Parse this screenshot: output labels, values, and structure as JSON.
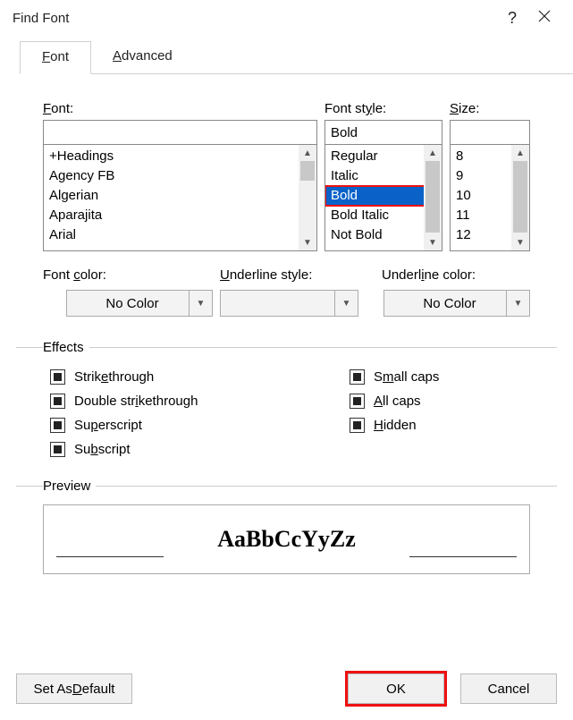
{
  "title": "Find Font",
  "tabs": {
    "font": "Font",
    "advanced": "Advanced"
  },
  "labels": {
    "font": "Font:",
    "style": "Font style:",
    "size": "Size:",
    "fontColor": "Font color:",
    "underlineStyle": "Underline style:",
    "underlineColor": "Underline color:"
  },
  "inputs": {
    "font": "",
    "style": "Bold",
    "size": ""
  },
  "fonts": [
    "+Headings",
    "Agency FB",
    "Algerian",
    "Aparajita",
    "Arial"
  ],
  "styles": [
    "Regular",
    "Italic",
    "Bold",
    "Bold Italic",
    "Not Bold"
  ],
  "styleSelectedIndex": 2,
  "sizes": [
    "8",
    "9",
    "10",
    "11",
    "12"
  ],
  "combos": {
    "fontColor": "No Color",
    "underlineStyle": "",
    "underlineColor": "No Color"
  },
  "effects": {
    "legend": "Effects",
    "left": [
      "Strikethrough",
      "Double strikethrough",
      "Superscript",
      "Subscript"
    ],
    "right": [
      "Small caps",
      "All caps",
      "Hidden"
    ]
  },
  "preview": {
    "legend": "Preview",
    "text": "AaBbCcYyZz"
  },
  "buttons": {
    "setDefault": "Set As Default",
    "ok": "OK",
    "cancel": "Cancel"
  }
}
